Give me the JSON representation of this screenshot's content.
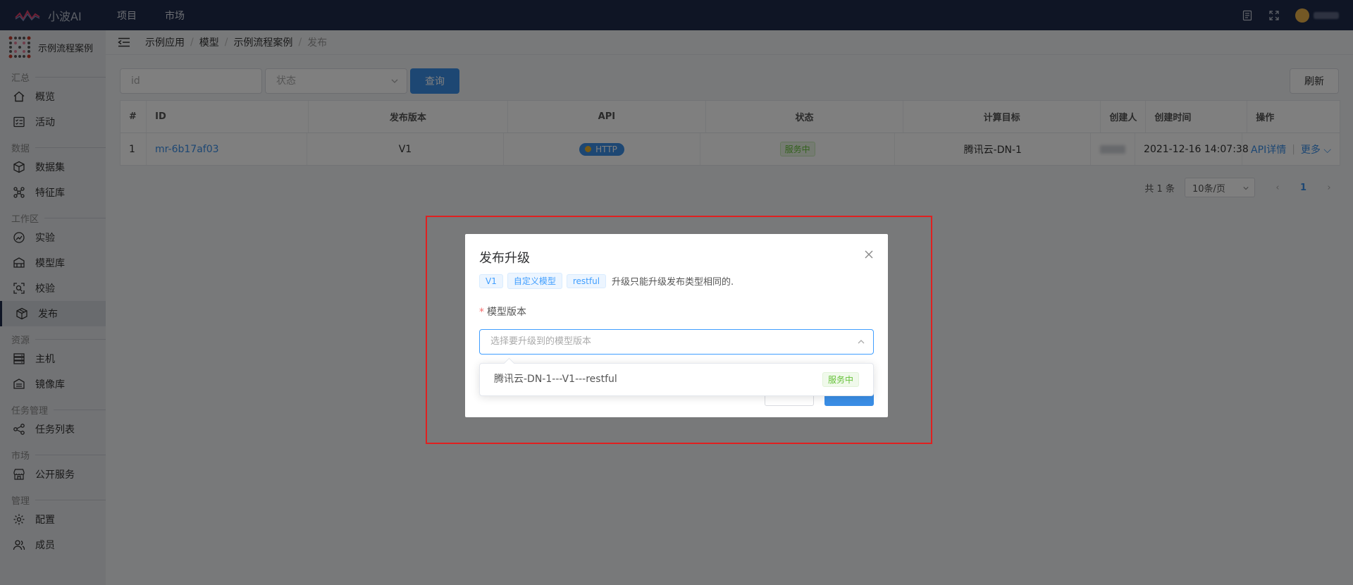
{
  "app": {
    "name": "小波AI"
  },
  "topnav": [
    {
      "label": "项目"
    },
    {
      "label": "市场"
    }
  ],
  "sidebar": {
    "project_name": "示例流程案例",
    "sections": [
      {
        "title": "汇总",
        "items": [
          {
            "label": "概览"
          },
          {
            "label": "活动"
          }
        ]
      },
      {
        "title": "数据",
        "items": [
          {
            "label": "数据集"
          },
          {
            "label": "特征库"
          }
        ]
      },
      {
        "title": "工作区",
        "items": [
          {
            "label": "实验"
          },
          {
            "label": "模型库"
          },
          {
            "label": "校验"
          },
          {
            "label": "发布"
          }
        ]
      },
      {
        "title": "资源",
        "items": [
          {
            "label": "主机"
          },
          {
            "label": "镜像库"
          }
        ]
      },
      {
        "title": "任务管理",
        "items": [
          {
            "label": "任务列表"
          }
        ]
      },
      {
        "title": "市场",
        "items": [
          {
            "label": "公开服务"
          }
        ]
      },
      {
        "title": "管理",
        "items": [
          {
            "label": "配置"
          },
          {
            "label": "成员"
          }
        ]
      }
    ]
  },
  "breadcrumb": [
    "示例应用",
    "模型",
    "示例流程案例",
    "发布"
  ],
  "filters": {
    "id_placeholder": "id",
    "status_placeholder": "状态",
    "query_label": "查询",
    "refresh_label": "刷新"
  },
  "table": {
    "headers": [
      "#",
      "ID",
      "发布版本",
      "API",
      "状态",
      "计算目标",
      "创建人",
      "创建时间",
      "操作"
    ],
    "rows": [
      {
        "index": "1",
        "id": "mr-6b17af03",
        "version": "V1",
        "api": "HTTP",
        "status": "服务中",
        "target": "腾讯云-DN-1",
        "created": "2021-12-16 14:07:38",
        "op_detail": "API详情",
        "op_more": "更多"
      }
    ]
  },
  "pagination": {
    "total": "共 1 条",
    "page_size": "10条/页",
    "current": "1"
  },
  "dialog": {
    "title": "发布升级",
    "tags": [
      "V1",
      "自定义模型",
      "restful"
    ],
    "note": "升级只能升级发布类型相同的.",
    "field_label": "模型版本",
    "select_placeholder": "选择要升级到的模型版本",
    "options": [
      {
        "label": "腾讯云-DN-1---V1---restful",
        "status": "服务中"
      }
    ]
  },
  "colors": {
    "topbar": "#1e2a4a",
    "primary": "#3a8ee6",
    "highlight": "#e02020",
    "success": "#67c23a"
  }
}
